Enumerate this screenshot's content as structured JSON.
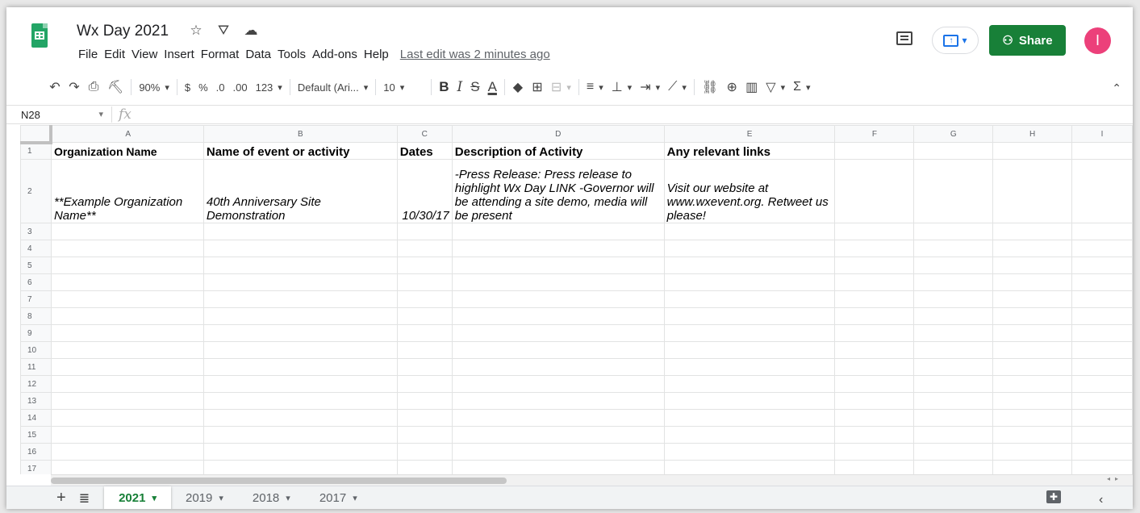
{
  "header": {
    "title": "Wx Day 2021",
    "menu": [
      "File",
      "Edit",
      "View",
      "Insert",
      "Format",
      "Data",
      "Tools",
      "Add-ons",
      "Help"
    ],
    "last_edit": "Last edit was 2 minutes ago",
    "share_label": "Share",
    "avatar_letter": "I"
  },
  "toolbar": {
    "zoom": "90%",
    "currency": "$",
    "percent": "%",
    "decrease_decimal": ".0",
    "increase_decimal": ".00",
    "more_formats": "123",
    "font": "Default (Ari...",
    "font_size": "10",
    "bold": "B",
    "italic": "I",
    "strike": "S",
    "text_color": "A",
    "functions": "Σ"
  },
  "formula_bar": {
    "cell_ref": "N28",
    "fx": "fx"
  },
  "sheet": {
    "columns": [
      "A",
      "B",
      "C",
      "D",
      "E",
      "F",
      "G",
      "H",
      "I"
    ],
    "row_numbers": [
      "1",
      "2",
      "3",
      "4",
      "5",
      "6",
      "7",
      "8",
      "9",
      "10",
      "11",
      "12",
      "13",
      "14",
      "15",
      "16",
      "17"
    ],
    "row1": [
      "Organization Name",
      "Name of event or activity",
      "Dates",
      "Description of Activity",
      "Any relevant links"
    ],
    "row2": [
      "**Example Organization Name**",
      "40th Anniversary Site Demonstration",
      "10/30/17",
      "-Press Release: Press release to highlight Wx Day LINK -Governor will be attending a site demo, media will be present",
      "Visit our website at www.wxevent.org. Retweet us please!"
    ]
  },
  "tabs": [
    "2021",
    "2019",
    "2018",
    "2017"
  ],
  "colors": {
    "share_green": "#188038",
    "logo_green": "#23a566",
    "avatar_pink": "#ec407a",
    "accent_blue": "#1a73e8"
  }
}
